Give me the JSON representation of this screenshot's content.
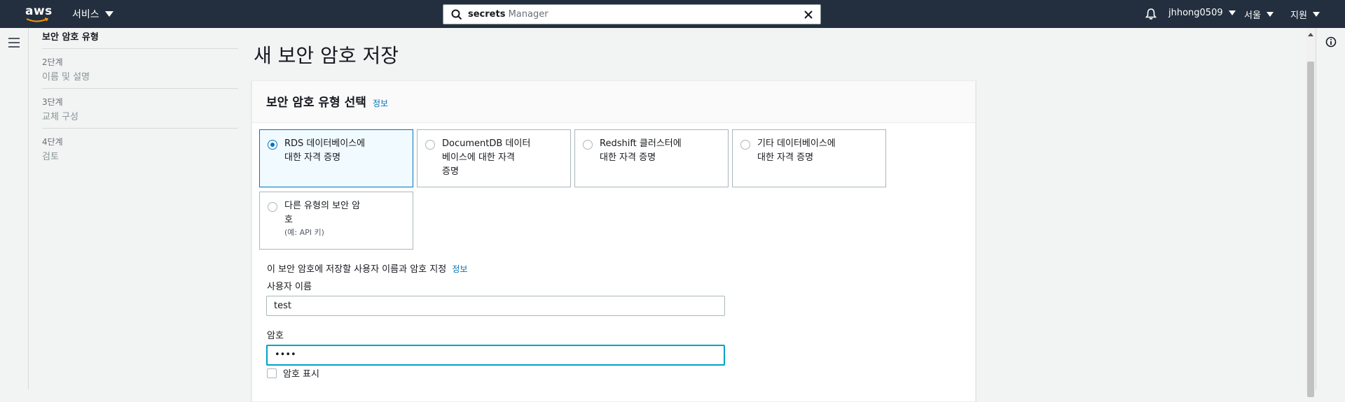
{
  "topnav": {
    "logo_text": "aws",
    "services_label": "서비스",
    "search": {
      "value_bold": "secrets",
      "value_rest": " Manager"
    },
    "user": "jhhong0509",
    "region": "서울",
    "support": "지원",
    "icons": {
      "search": "search-icon",
      "clear": "close-icon",
      "notifications": "bell-icon",
      "menu": "hamburger-menu-icon",
      "info": "info-icon"
    }
  },
  "steps": {
    "current": "보안 암호 유형",
    "items": [
      {
        "num": "2단계",
        "name": "이름 및 설명"
      },
      {
        "num": "3단계",
        "name": "교체 구성"
      },
      {
        "num": "4단계",
        "name": "검토"
      }
    ]
  },
  "page": {
    "title": "새 보안 암호 저장"
  },
  "panel": {
    "title": "보안 암호 유형 선택",
    "info": "정보",
    "tiles": [
      {
        "line1": "RDS 데이터베이스에",
        "line2": "대한 자격 증명",
        "line3": "",
        "selected": true
      },
      {
        "line1": "DocumentDB 데이터",
        "line2": "베이스에 대한 자격",
        "line3": "증명",
        "selected": false
      },
      {
        "line1": "Redshift 클러스터에",
        "line2": "대한 자격 증명",
        "line3": "",
        "selected": false
      },
      {
        "line1": "기타 데이터베이스에",
        "line2": "대한 자격 증명",
        "line3": "",
        "selected": false
      },
      {
        "line1": "다른 유형의 보안 암",
        "line2": "호",
        "line3": "(예: API 키)",
        "selected": false
      }
    ],
    "credentials_heading": "이 보안 암호에 저장할 사용자 이름과 암호 지정",
    "credentials_info": "정보",
    "username_label": "사용자 이름",
    "username_value": "test",
    "password_label": "암호",
    "password_value": "••••",
    "show_password_label": "암호 표시"
  }
}
